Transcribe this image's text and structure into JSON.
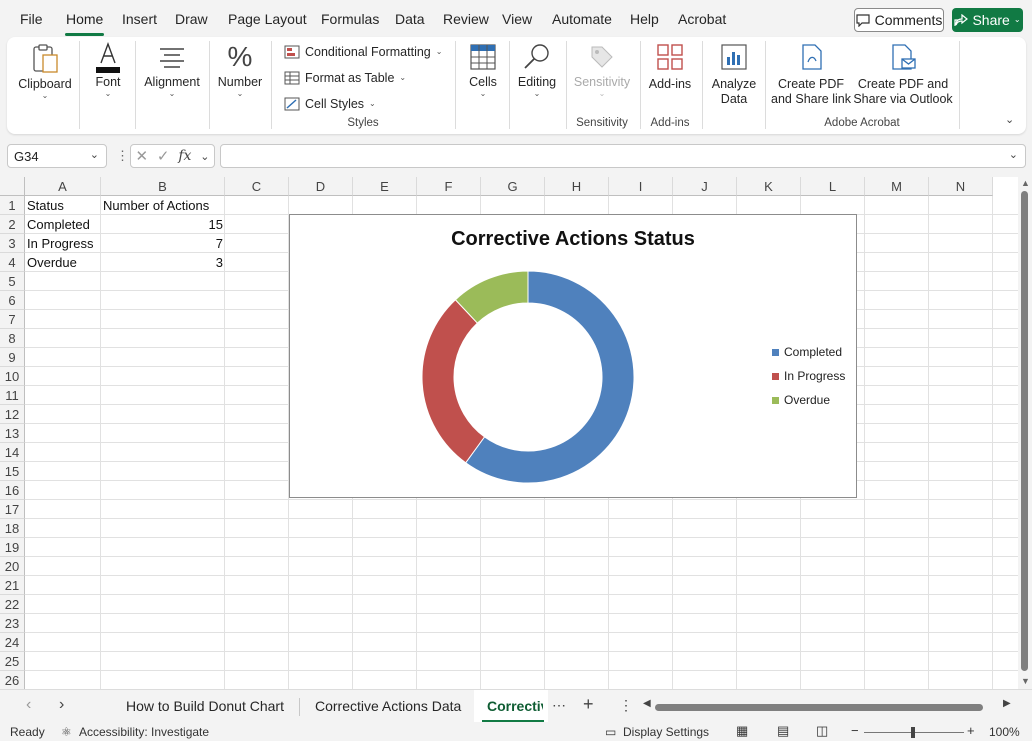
{
  "menu": {
    "file": "File",
    "home": "Home",
    "insert": "Insert",
    "draw": "Draw",
    "page_layout": "Page Layout",
    "formulas": "Formulas",
    "data": "Data",
    "review": "Review",
    "view": "View",
    "automate": "Automate",
    "help": "Help",
    "acrobat": "Acrobat"
  },
  "header": {
    "comments": "Comments",
    "share": "Share"
  },
  "ribbon": {
    "clipboard": "Clipboard",
    "font": "Font",
    "alignment": "Alignment",
    "number": "Number",
    "conditional_formatting": "Conditional Formatting",
    "format_as_table": "Format as Table",
    "cell_styles": "Cell Styles",
    "styles_group": "Styles",
    "cells": "Cells",
    "editing": "Editing",
    "sensitivity": "Sensitivity",
    "sensitivity_group": "Sensitivity",
    "add_ins": "Add-ins",
    "add_ins_group": "Add-ins",
    "analyze_data_1": "Analyze",
    "analyze_data_2": "Data",
    "create_pdf_link_1": "Create PDF",
    "create_pdf_link_2": "and Share link",
    "create_pdf_outlook_1": "Create PDF and",
    "create_pdf_outlook_2": "Share via Outlook",
    "adobe_group": "Adobe Acrobat"
  },
  "formula_bar": {
    "name_box": "G34",
    "fx": "fx",
    "value": ""
  },
  "columns": [
    "A",
    "B",
    "C",
    "D",
    "E",
    "F",
    "G",
    "H",
    "I",
    "J",
    "K",
    "L",
    "M",
    "N"
  ],
  "rows": [
    "1",
    "2",
    "3",
    "4",
    "5",
    "6",
    "7",
    "8",
    "9",
    "10",
    "11",
    "12",
    "13",
    "14",
    "15",
    "16",
    "17",
    "18",
    "19",
    "20",
    "21",
    "22",
    "23",
    "24",
    "25",
    "26"
  ],
  "cells": {
    "A1": "Status",
    "B1": "Number of Actions",
    "A2": "Completed",
    "B2": "15",
    "A3": "In Progress",
    "B3": "7",
    "A4": "Overdue",
    "B4": "3"
  },
  "chart_data": {
    "type": "pie",
    "subtype": "donut",
    "title": "Corrective Actions Status",
    "categories": [
      "Completed",
      "In Progress",
      "Overdue"
    ],
    "values": [
      15,
      7,
      3
    ],
    "colors": [
      "#4f81bd",
      "#c0504d",
      "#9bbb59"
    ],
    "legend_position": "right"
  },
  "sheet_tabs": {
    "tab1": "How to Build Donut Chart",
    "tab2": "Corrective Actions Data",
    "tab3": "Correctiv"
  },
  "status": {
    "ready": "Ready",
    "accessibility": "Accessibility: Investigate",
    "display_settings": "Display Settings",
    "zoom": "100%"
  }
}
